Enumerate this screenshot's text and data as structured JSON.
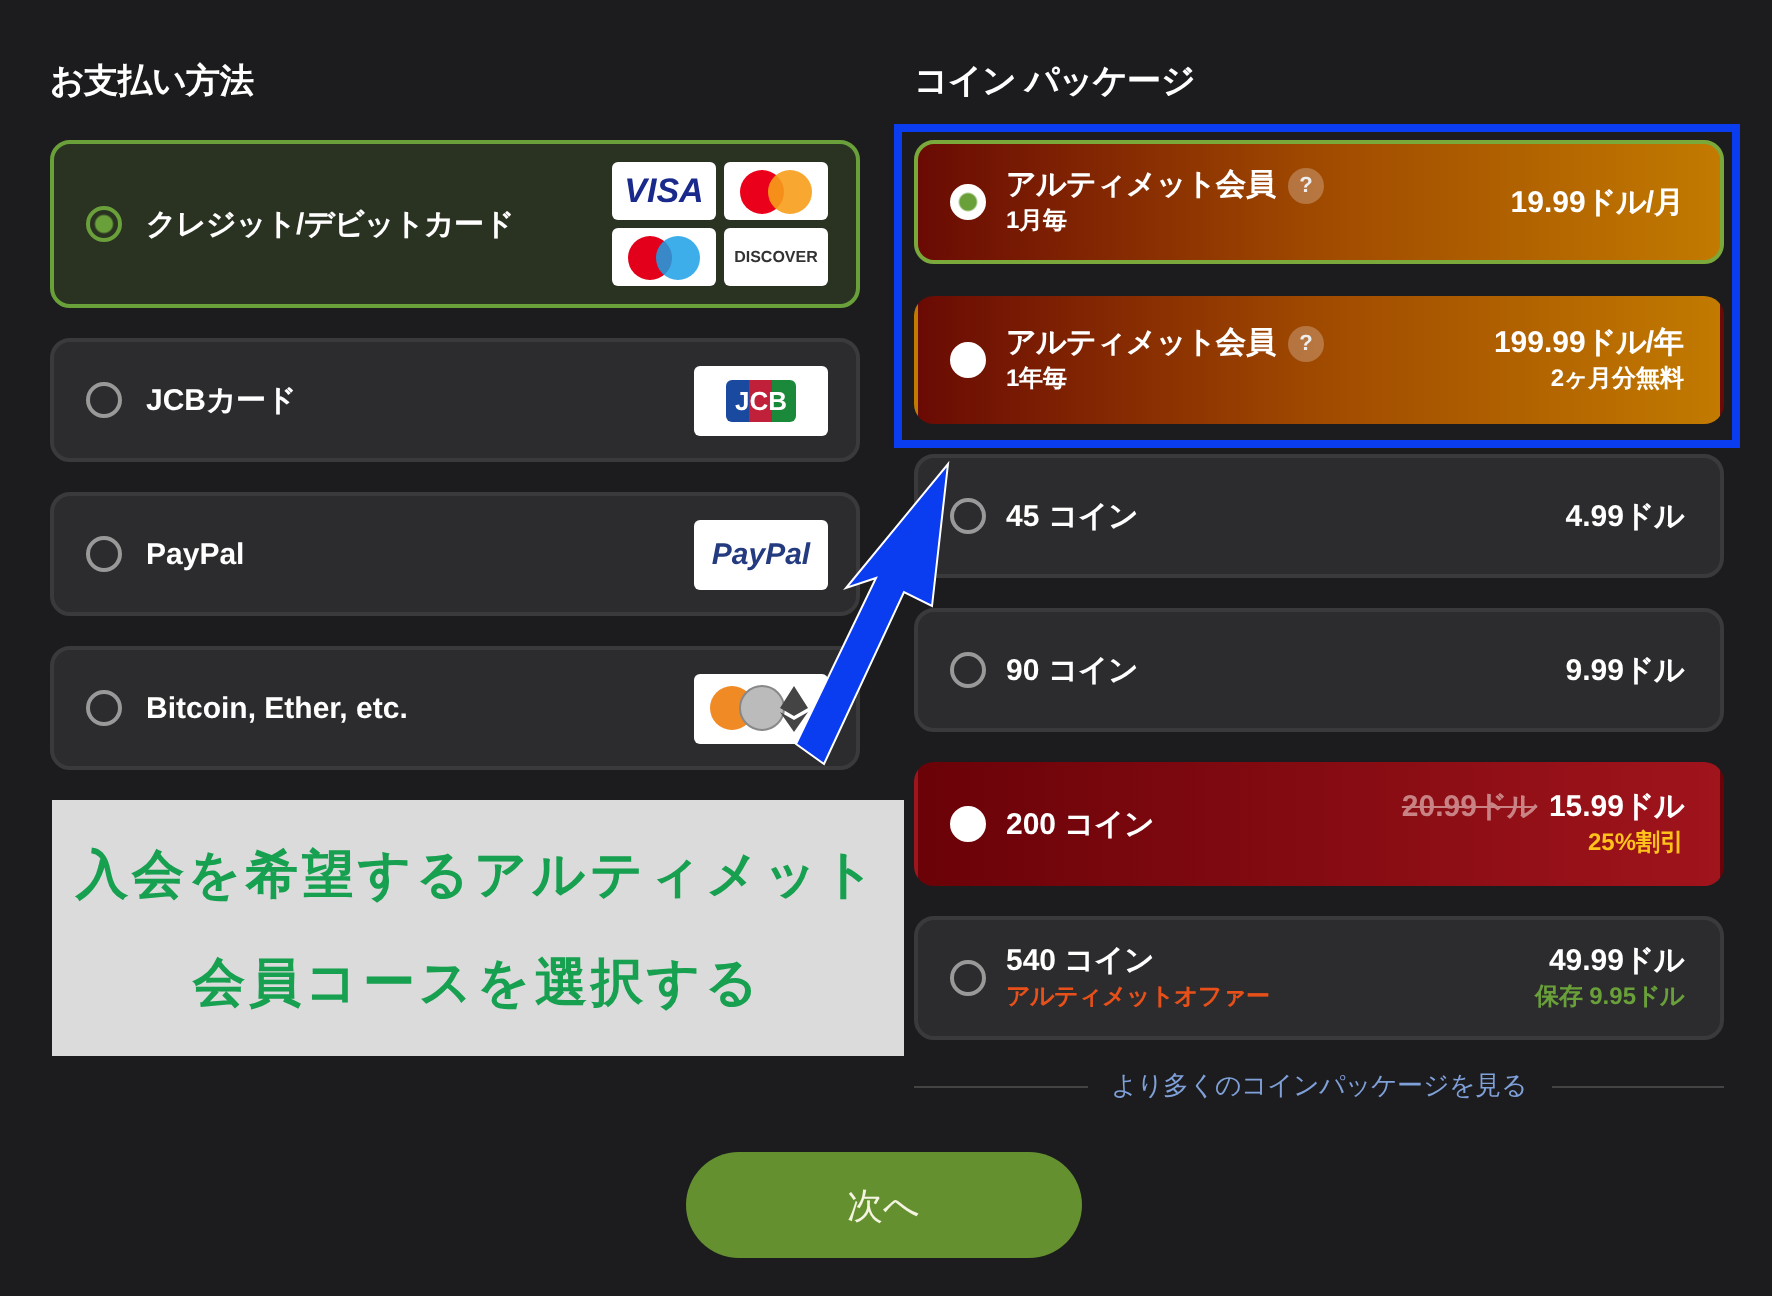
{
  "payment": {
    "title": "お支払い方法",
    "methods": [
      {
        "label": "クレジット/デビットカード",
        "selected": true,
        "logos": [
          {
            "kind": "visa",
            "text": "VISA"
          },
          {
            "kind": "mastercard"
          },
          {
            "kind": "maestro"
          },
          {
            "kind": "discover",
            "text": "DISCOVER"
          }
        ]
      },
      {
        "label": "JCBカード",
        "selected": false,
        "logos": [
          {
            "kind": "jcb",
            "text": "JCB"
          }
        ]
      },
      {
        "label": "PayPal",
        "selected": false,
        "logos": [
          {
            "kind": "paypal",
            "text": "PayPal"
          }
        ]
      },
      {
        "label": "Bitcoin, Ether, etc.",
        "selected": false,
        "logos": [
          {
            "kind": "crypto"
          }
        ]
      }
    ]
  },
  "packages": {
    "title": "コイン パッケージ",
    "items": [
      {
        "kind": "membership",
        "name": "アルティメット会員",
        "help": "?",
        "sub": "1月毎",
        "price": "19.99ドル/月",
        "selected": true,
        "highlighted": true
      },
      {
        "kind": "membership",
        "name": "アルティメット会員",
        "help": "?",
        "sub": "1年毎",
        "price": "199.99ドル/年",
        "note": "2ヶ月分無料",
        "selected": false,
        "highlighted": true
      },
      {
        "kind": "coin",
        "name": "45 コイン",
        "price": "4.99ドル",
        "selected": false,
        "highlighted": false
      },
      {
        "kind": "coin",
        "name": "90 コイン",
        "price": "9.99ドル",
        "selected": false,
        "highlighted": false
      },
      {
        "kind": "sale",
        "name": "200 コイン",
        "old_price": "20.99ドル",
        "price": "15.99ドル",
        "note": "25%割引",
        "selected": false,
        "highlighted": false
      },
      {
        "kind": "offer",
        "name": "540 コイン",
        "sub": "アルティメットオファー",
        "price": "49.99ドル",
        "note": "保存 9.95ドル",
        "selected": false,
        "highlighted": false
      }
    ],
    "more_link": "より多くのコインパッケージを見る"
  },
  "next_button": "次へ",
  "annotation": {
    "lines": [
      "入会を希望するアルティメット",
      "会員コースを選択する"
    ]
  }
}
